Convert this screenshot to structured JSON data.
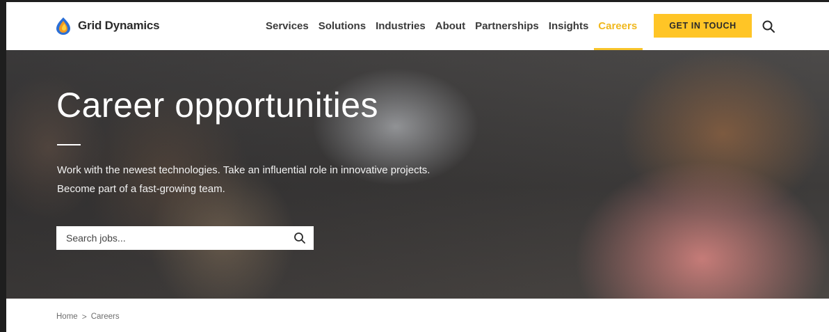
{
  "brand": {
    "name": "Grid Dynamics",
    "colors": {
      "accent": "#ffc526",
      "active_nav": "#f0b81e",
      "logo_blue": "#2b6fd6",
      "logo_orange": "#f29a22"
    }
  },
  "nav": {
    "items": [
      {
        "label": "Services",
        "active": false
      },
      {
        "label": "Solutions",
        "active": false
      },
      {
        "label": "Industries",
        "active": false
      },
      {
        "label": "About",
        "active": false
      },
      {
        "label": "Partnerships",
        "active": false
      },
      {
        "label": "Insights",
        "active": false
      },
      {
        "label": "Careers",
        "active": true
      }
    ],
    "cta_label": "GET IN TOUCH",
    "search_icon": "search-icon"
  },
  "hero": {
    "title": "Career opportunities",
    "subtitle_lines": [
      "Work with the newest technologies. Take an influential role in innovative projects.",
      "Become part of a fast-growing team."
    ],
    "search": {
      "placeholder": "Search jobs...",
      "value": ""
    }
  },
  "breadcrumb": {
    "items": [
      "Home",
      "Careers"
    ],
    "separator": ">"
  }
}
